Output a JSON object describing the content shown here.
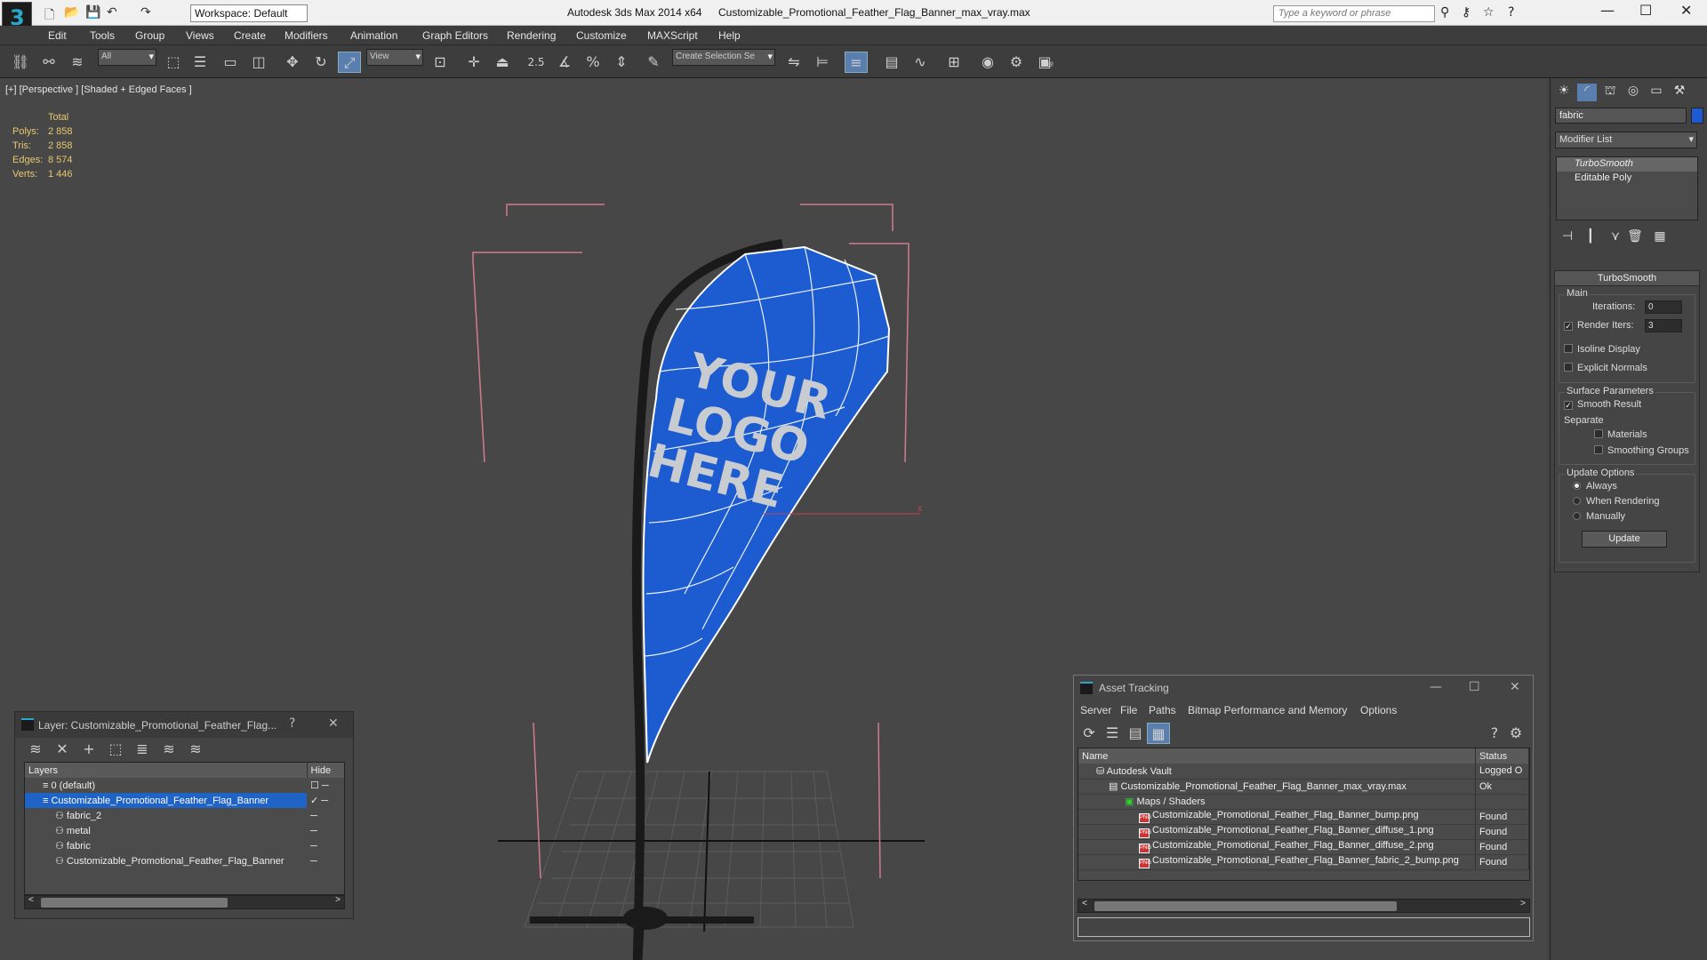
{
  "app": {
    "workspace_value": "Workspace: Default",
    "app_title": "Autodesk 3ds Max 2014 x64",
    "file_title": "Customizable_Promotional_Feather_Flag_Banner_max_vray.max",
    "search_placeholder": "Type a keyword or phrase"
  },
  "menus": [
    "Edit",
    "Tools",
    "Group",
    "Views",
    "Create",
    "Modifiers",
    "Animation",
    "Graph Editors",
    "Rendering",
    "Customize",
    "MAXScript",
    "Help"
  ],
  "toolbar": {
    "selection_filter": "All",
    "ref_coord": "View",
    "snap_value": "2.5",
    "named_selection_placeholder": "Create Selection Se"
  },
  "viewport": {
    "label": "[+] [Perspective ] [Shaded + Edged Faces ]",
    "stats": {
      "header": "Total",
      "rows": [
        {
          "label": "Polys:",
          "value": "2 858"
        },
        {
          "label": "Tris:",
          "value": "2 858"
        },
        {
          "label": "Edges:",
          "value": "8 574"
        },
        {
          "label": "Verts:",
          "value": "1 446"
        }
      ]
    },
    "flag_text": [
      "YOUR",
      "LOGO",
      "HERE"
    ],
    "colors": {
      "flag": "#1c5cd0",
      "bounding_box": "#d37a8e",
      "pole": "#1a1a1a"
    }
  },
  "command_panel": {
    "object_name": "fabric",
    "modifier_list": "Modifier List",
    "stack": [
      "TurboSmooth",
      "Editable Poly"
    ],
    "rollout_title": "TurboSmooth",
    "main_group": "Main",
    "iterations_label": "Iterations:",
    "iterations_value": "0",
    "render_iters_label": "Render Iters:",
    "render_iters_value": "3",
    "render_iters_checked": true,
    "isoline_label": "Isoline Display",
    "explicit_normals_label": "Explicit Normals",
    "surface_group": "Surface Parameters",
    "smooth_result_label": "Smooth Result",
    "separate_label": "Separate",
    "materials_label": "Materials",
    "smoothing_groups_label": "Smoothing Groups",
    "update_group": "Update Options",
    "update_always": "Always",
    "update_when_rendering": "When Rendering",
    "update_manually": "Manually",
    "update_button": "Update"
  },
  "layer_dialog": {
    "title": "Layer: Customizable_Promotional_Feather_Flag...",
    "help": "?",
    "col_layers": "Layers",
    "col_hide": "Hide",
    "rows": [
      {
        "name": "0 (default)",
        "indent": 0
      },
      {
        "name": "Customizable_Promotional_Feather_Flag_Banner",
        "indent": 0,
        "selected": true
      },
      {
        "name": "fabric_2",
        "indent": 1
      },
      {
        "name": "metal",
        "indent": 1
      },
      {
        "name": "fabric",
        "indent": 1
      },
      {
        "name": "Customizable_Promotional_Feather_Flag_Banner",
        "indent": 1
      }
    ]
  },
  "asset_tracking": {
    "title": "Asset Tracking",
    "menus": [
      "Server",
      "File",
      "Paths",
      "Bitmap Performance and Memory",
      "Options"
    ],
    "col_name": "Name",
    "col_status": "Status",
    "rows": [
      {
        "name": "Autodesk Vault",
        "status": "Logged O",
        "level": 0,
        "icon": "vault"
      },
      {
        "name": "Customizable_Promotional_Feather_Flag_Banner_max_vray.max",
        "status": "Ok",
        "level": 1,
        "icon": "max"
      },
      {
        "name": "Maps / Shaders",
        "status": "",
        "level": 2,
        "icon": "maps"
      },
      {
        "name": "Customizable_Promotional_Feather_Flag_Banner_bump.png",
        "status": "Found",
        "level": 3,
        "icon": "png"
      },
      {
        "name": "Customizable_Promotional_Feather_Flag_Banner_diffuse_1.png",
        "status": "Found",
        "level": 3,
        "icon": "png"
      },
      {
        "name": "Customizable_Promotional_Feather_Flag_Banner_diffuse_2.png",
        "status": "Found",
        "level": 3,
        "icon": "png"
      },
      {
        "name": "Customizable_Promotional_Feather_Flag_Banner_fabric_2_bump.png",
        "status": "Found",
        "level": 3,
        "icon": "png"
      }
    ]
  }
}
